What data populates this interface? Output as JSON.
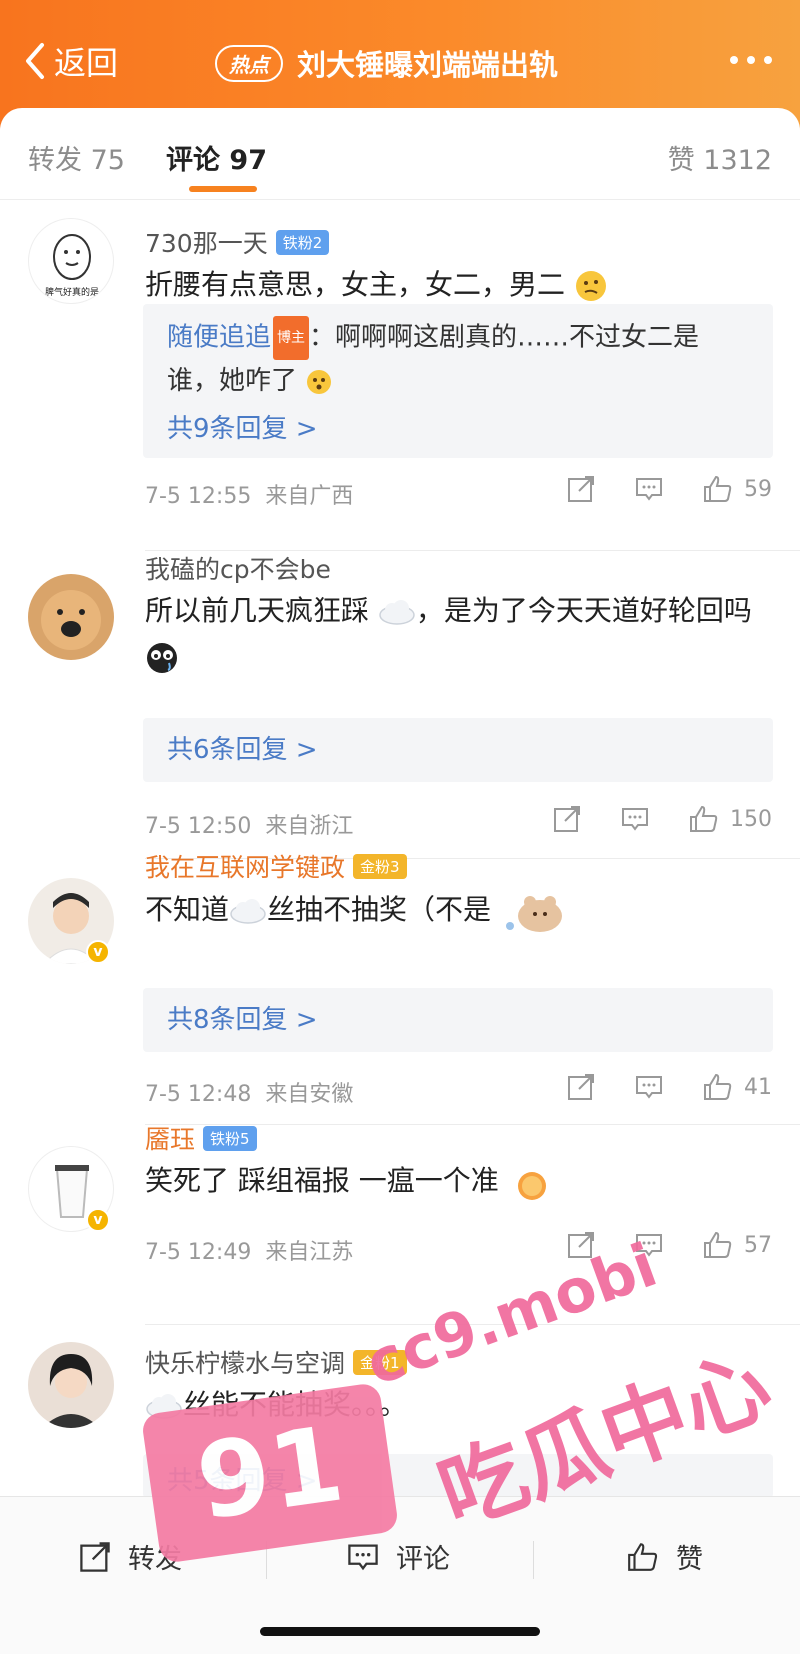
{
  "header": {
    "back_label": "返回",
    "hot_badge": "热点",
    "title": "刘大锤曝刘端端出轨"
  },
  "tabs": {
    "repost_label": "转发",
    "repost_count": "75",
    "comment_label": "评论",
    "comment_count": "97",
    "like_label": "赞",
    "like_count": "1312"
  },
  "comments": [
    {
      "username": "730那一天",
      "fan_badge": "铁粉2",
      "text": "折腰有点意思，女主，女二，男二",
      "avatar_text": "脾气好真的是",
      "reply_user": "随便追追",
      "reply_badge": "博主",
      "reply_text": "：啊啊啊这剧真的……不过女二是谁，她咋了",
      "more_replies": "共9条回复 >",
      "time": "7-5 12:55",
      "location": "来自广西",
      "likes": "59"
    },
    {
      "username": "我磕的cp不会be",
      "text": "所以前几天疯狂踩",
      "text2": "，是为了今天天道好轮回吗",
      "more_replies": "共6条回复 >",
      "time": "7-5 12:50",
      "location": "来自浙江",
      "likes": "150"
    },
    {
      "username": "我在互联网学键政",
      "fan_badge": "金粉3",
      "text": "不知道",
      "text2": "丝抽不抽奖（不是",
      "more_replies": "共8条回复 >",
      "time": "7-5 12:48",
      "location": "来自安徽",
      "likes": "41"
    },
    {
      "username": "靥珏",
      "fan_badge": "铁粉5",
      "text": "笑死了 踩组福报 一瘟一个准",
      "time": "7-5 12:49",
      "location": "来自江苏",
      "likes": "57"
    },
    {
      "username": "快乐柠檬水与空调",
      "fan_badge": "金粉1",
      "text": "丝能不能抽奖。。。",
      "more_replies": "共5条回复 >"
    }
  ],
  "bottom_bar": {
    "repost": "转发",
    "comment": "评论",
    "like": "赞"
  },
  "watermark": {
    "number": "91",
    "site": "cc9.mobi",
    "text": "吃瓜中心"
  },
  "colors": {
    "header_orange": "#f8741e",
    "accent": "#f7821f",
    "link_blue": "#4a7bc6"
  }
}
